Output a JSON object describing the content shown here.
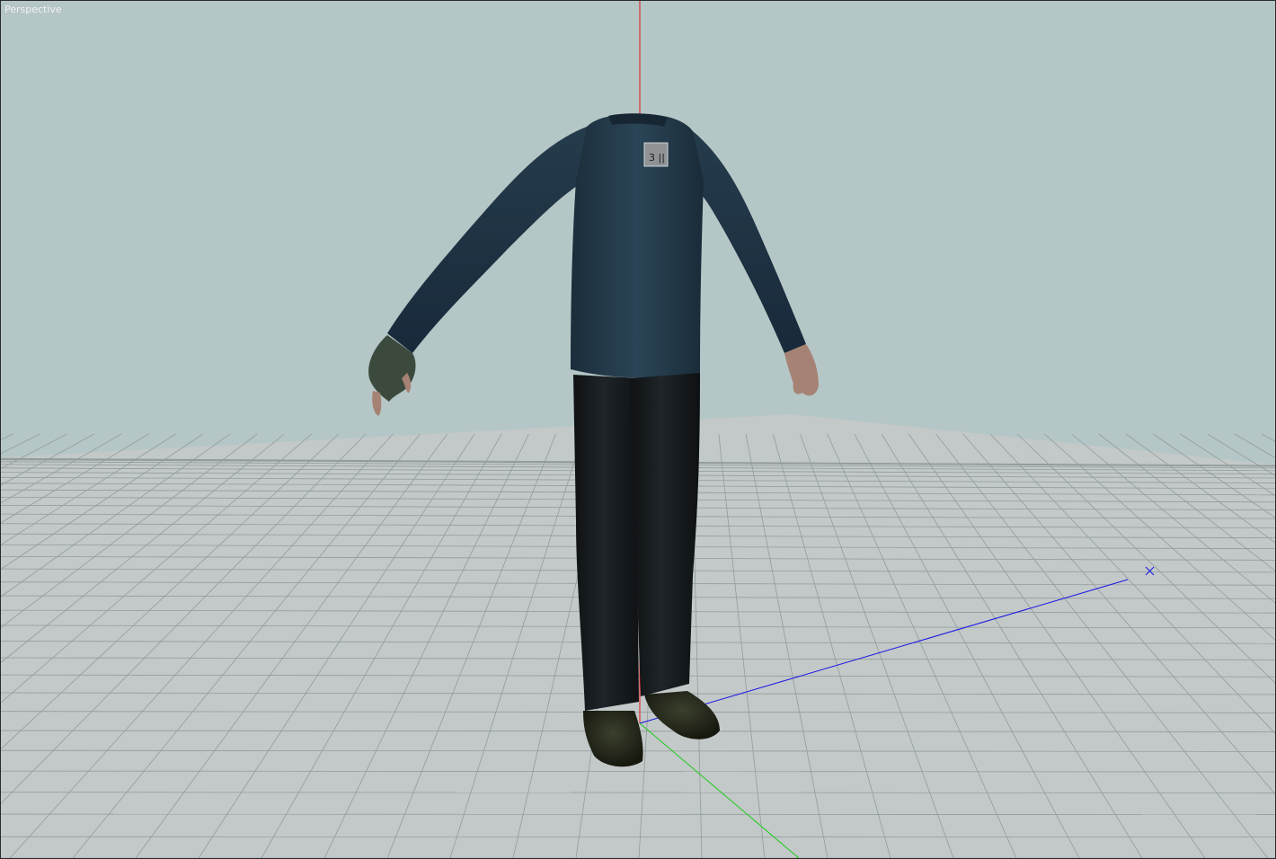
{
  "viewport": {
    "label": "Perspective",
    "background_color": "#b5c6c6",
    "floor_color": "#c4c9c9",
    "grid_color": "#8f9a9a",
    "axis_colors": {
      "x_red": "#e01818",
      "y_green": "#19cc19",
      "z_blue": "#1414e6"
    }
  },
  "model": {
    "name_icon": "headless-character-model",
    "shirt_color": "#23394a",
    "pants_color": "#15191c",
    "glove_color": "#3c4a3e",
    "boot_color": "#2c3022",
    "skin_color": "#a58273",
    "badge_text": "3 ||"
  }
}
